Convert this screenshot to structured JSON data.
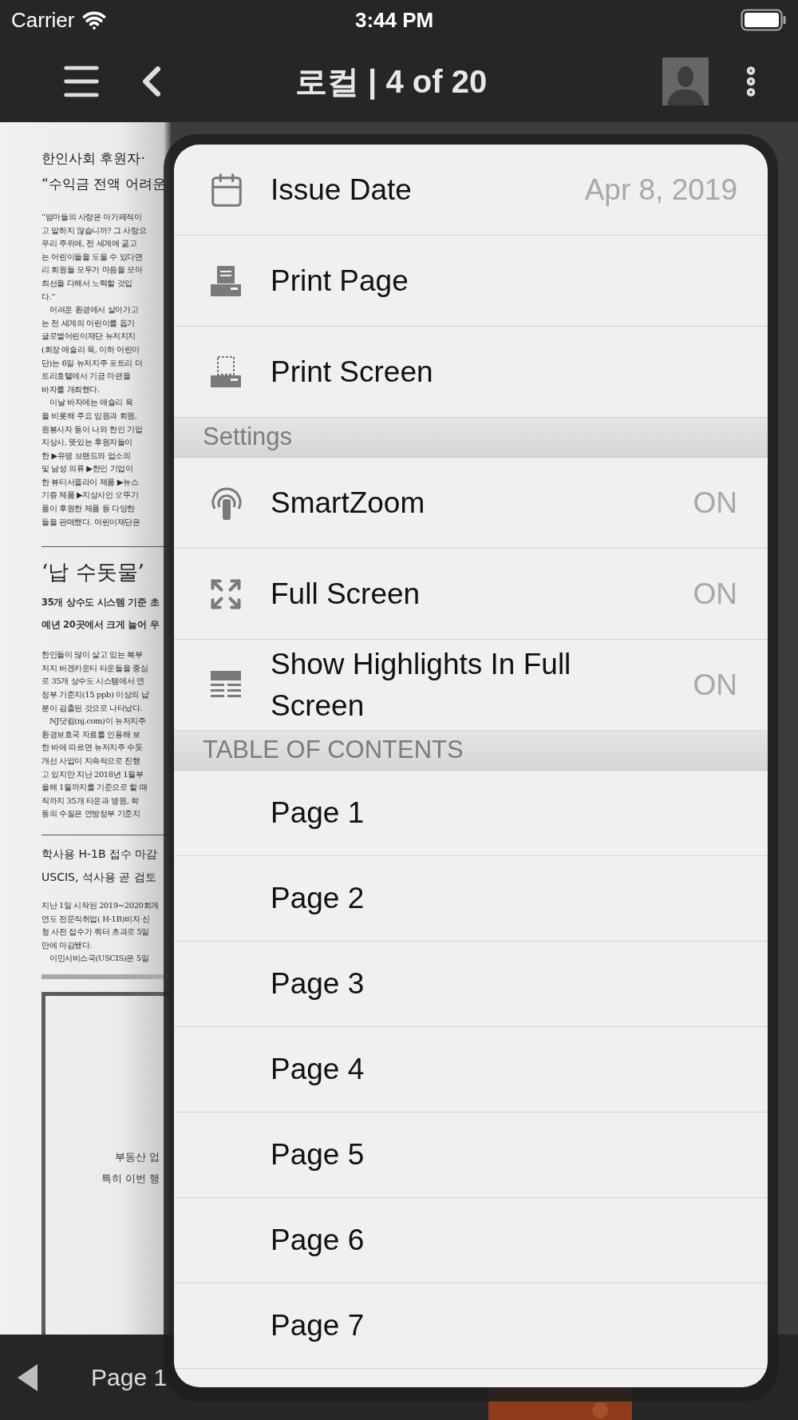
{
  "status_bar": {
    "carrier": "Carrier",
    "time": "3:44 PM"
  },
  "nav_bar": {
    "title": "로컬 | 4 of 20"
  },
  "newspaper": {
    "articles": [
      {
        "titles": [
          "한인사회 후원자·",
          "“수익금 전액 어려운"
        ],
        "paragraphs": [
          [
            "“엄마들의 사랑은 아가페적이",
            "고 말하지 않습니까? 그 사랑으",
            "우리 주위에, 전 세계에 굶고",
            "는 어린이들을 도울 수 있다면",
            "리 회원들 모두가 마음을 모아",
            "최선을 다해서 노력할 것입",
            "다.”"
          ],
          [
            "어려운 환경에서 살아가고",
            "는 전 세계의 어린이를 돕기",
            "글로벌어린이재단 뉴저지지",
            "(회장 애슐리 육, 이하 어린이",
            "단)는 6일 뉴저지주 포트리 더",
            "트리호텔에서 기금 마련을",
            "바자를 개최했다."
          ],
          [
            "이날 바자에는 애슐리 육",
            "을 비롯해 주요 임원과 회원,",
            "원봉사자 등이 나와 한인 기업",
            "지상사, 뜻있는 후원자들이",
            "한 ▶유명 브랜드와 업소의",
            "및 남성 의류 ▶한인 기업이",
            "한 뷰티서플라이 제품 ▶뉴스",
            "기증 제품 ▶지상사인 오뚜기",
            "품이 후원한 제품 등 다양한",
            "들을 판매했다. 어린이재단은"
          ]
        ]
      },
      {
        "titles": [
          "‘납 수돗물’"
        ],
        "subtitles": [
          "35개 상수도 시스템 기준 초",
          "예년 20곳에서 크게 늘어 우"
        ],
        "paragraphs": [
          [
            "한인들이 많이 살고 있는 북부",
            "저지 버겐카운티 타운들을 중심",
            "로 35개 상수도 시스템에서 연",
            "정부 기준치(15 ppb) 이상의 납",
            "분이 검출된 것으로 나타났다."
          ],
          [
            "NJ닷컴(nj.com)이 뉴저지주",
            "환경보호국 자료를 인용해 보",
            "한 바에 따르면 뉴저지주 수돗",
            "개선 사업이 지속적으로 진행",
            "고 있지만 지난 2018년 1월부",
            "올해 1월까지를 기준으로 할 때",
            "직까지 35개 타운과 병원, 학",
            "등의 수질은 연방정부 기준치"
          ]
        ]
      },
      {
        "titles": [
          "학사용 H-1B 접수 마감",
          "USCIS, 석사용 곧 검토"
        ],
        "paragraphs": [
          [
            "지난 1일 시작된 2019~2020회계",
            "연도 전문직취업( H-1B)비자 신",
            "청 사전 접수가 쿼터 초과로 5일",
            "만에 마감됐다."
          ],
          [
            "이민서비스국(USCIS)은 5일"
          ]
        ]
      }
    ],
    "ad": {
      "lines": [
        "부동산 업",
        "특히 이번 행"
      ]
    }
  },
  "menu": {
    "sections": [
      {
        "items": [
          {
            "kind": "calendar",
            "label": "Issue Date",
            "value": "Apr 8, 2019"
          },
          {
            "kind": "print_page",
            "label": "Print Page"
          },
          {
            "kind": "print_screen",
            "label": "Print Screen"
          }
        ]
      },
      {
        "header": "Settings",
        "items": [
          {
            "kind": "smartzoom",
            "label": "SmartZoom",
            "value": "ON"
          },
          {
            "kind": "fullscreen",
            "label": "Full Screen",
            "value": "ON"
          },
          {
            "kind": "highlights",
            "label": "Show Highlights In Full Screen",
            "value": "ON"
          }
        ]
      },
      {
        "header": "TABLE OF CONTENTS",
        "items": [
          {
            "kind": "page",
            "label": "Page 1"
          },
          {
            "kind": "page",
            "label": "Page 2"
          },
          {
            "kind": "page",
            "label": "Page 3"
          },
          {
            "kind": "page",
            "label": "Page 4"
          },
          {
            "kind": "page",
            "label": "Page 5"
          },
          {
            "kind": "page",
            "label": "Page 6"
          },
          {
            "kind": "page",
            "label": "Page 7"
          }
        ]
      }
    ]
  },
  "bottom_bar": {
    "page_label": "Page 1"
  }
}
